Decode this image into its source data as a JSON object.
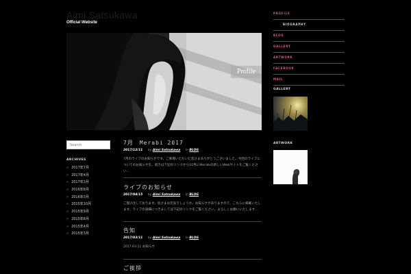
{
  "site": {
    "title": "Aimi Satsukawa",
    "tagline": "Official Website"
  },
  "hero": {
    "label": "Profile"
  },
  "search": {
    "placeholder": "Search"
  },
  "archives": {
    "title": "ARCHIVES",
    "items": [
      "2017年7月",
      "2017年4月",
      "2017年3月",
      "2016年8月",
      "2016年3月",
      "2015年10月",
      "2015年9月",
      "2015年8月",
      "2015年4月",
      "2015年3月"
    ]
  },
  "posts": [
    {
      "title": "7月　Merabi 2017",
      "date": "2017/12/11",
      "author_prefix": "by",
      "author": "Aimi Satsukawa",
      "category_prefix": "in",
      "category": "BLOG",
      "excerpt": "7月のライブのお知らせです。ご来場いただいた皆さまありがとうございました。今回のライブについてのお知らせを。続きは下記のリンクから10月にMerabiの新しいWebサイトをご覧ください…"
    },
    {
      "title": "ライブのお知らせ",
      "date": "2017/04/15",
      "author_prefix": "by",
      "author": "Aimi Satsukawa",
      "category_prefix": "in",
      "category": "BLOG",
      "excerpt": "ご無沙汰しております。皆さまお元気でしょうか。お知らせがありますので、こちらに掲載いたします。ライブの詳細につきましては下記のリンクをご覧ください。よろしくお願いいたします…"
    },
    {
      "title": "告知",
      "date": "2017/03/11",
      "author_prefix": "by",
      "author": "Aimi Satsukawa",
      "category_prefix": "in",
      "category": "BLOG",
      "excerpt": "2017.03.11 お知らせ"
    },
    {
      "title": "ご挨拶"
    }
  ],
  "nav": {
    "items": [
      {
        "label": "PROFILE",
        "color": "#e0607a"
      },
      {
        "label": "BIOGRAPHY",
        "color": "#dddddd"
      },
      {
        "label": "BLOG",
        "color": "#e0607a"
      },
      {
        "label": "GALLERY",
        "color": "#e0607a"
      },
      {
        "label": "ARTWORK",
        "color": "#e0607a"
      },
      {
        "label": "FACEBOOK",
        "color": "#e0607a"
      },
      {
        "label": "MAIL",
        "color": "#e0607a"
      }
    ]
  },
  "gallery": {
    "title": "GALLERY"
  },
  "artwork": {
    "title": "ARTWORK"
  },
  "colors": {
    "background": "#000000",
    "accent": "#e0607a",
    "text": "#aaaaaa"
  }
}
